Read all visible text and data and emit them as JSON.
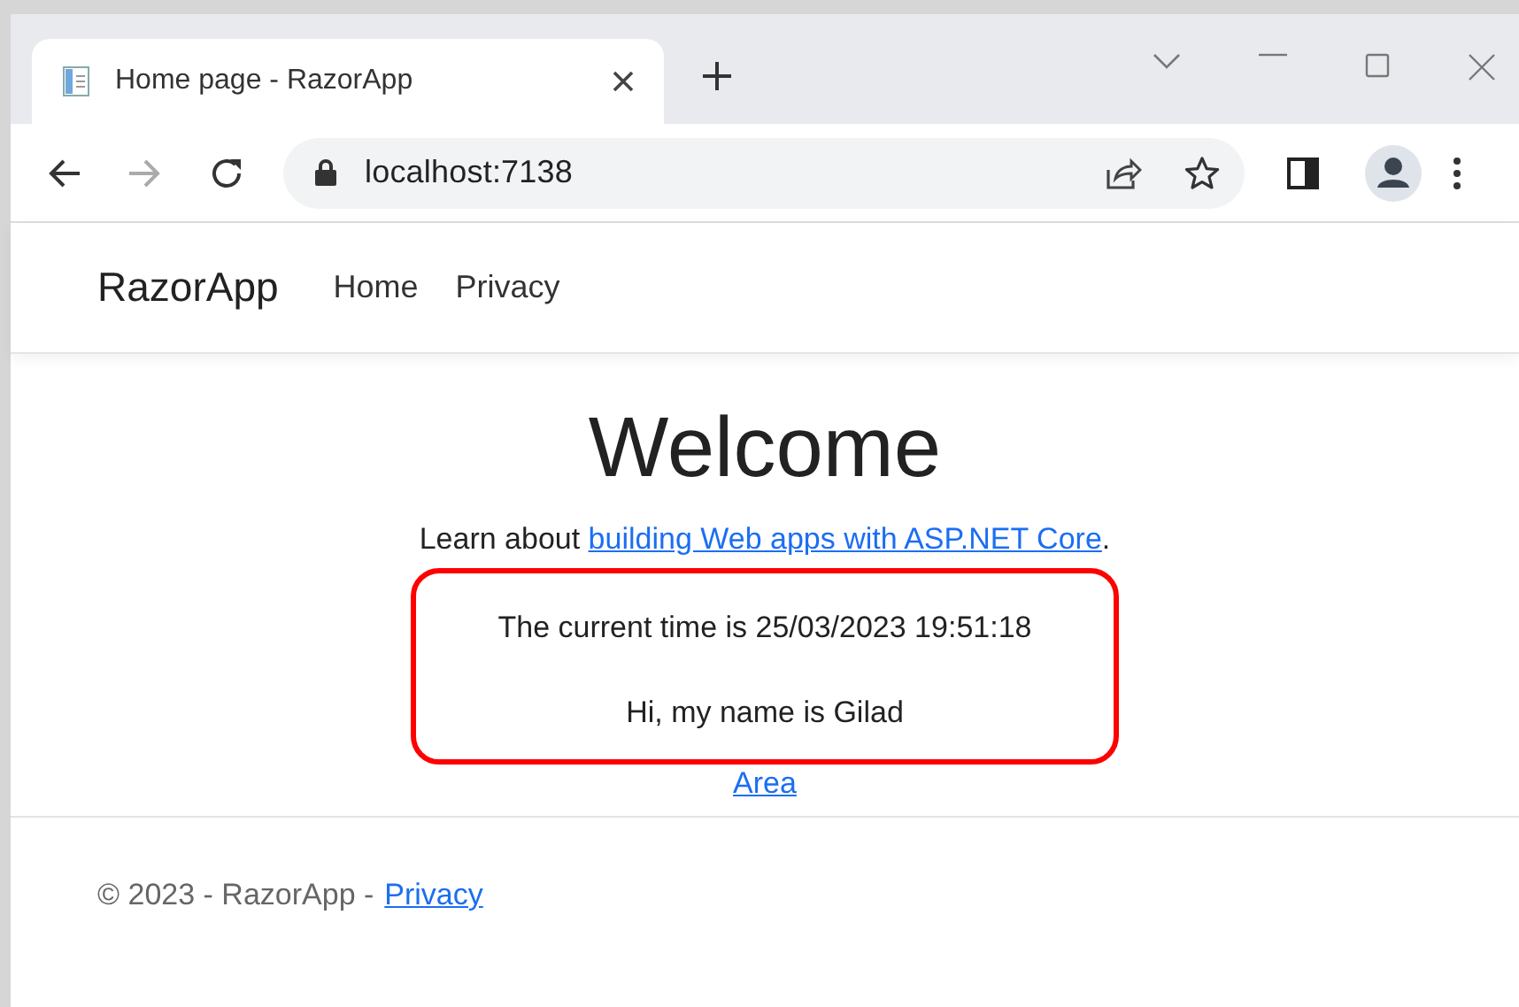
{
  "browser": {
    "tabs": [
      {
        "title": "Home page - RazorApp",
        "selected": true
      }
    ],
    "nav_buttons": [
      {
        "kind": "back",
        "disabled": false
      },
      {
        "kind": "forward",
        "disabled": true
      },
      {
        "kind": "reload",
        "disabled": false
      }
    ],
    "address": "localhost:7138"
  },
  "navbar": {
    "brand": "RazorApp",
    "links": [
      "Home",
      "Privacy"
    ]
  },
  "main": {
    "heading": "Welcome",
    "intro_before": "Learn about",
    "intro_link": "building Web apps with ASP.NET Core",
    "intro_after": ".",
    "highlighted_lines": [
      "The current time is 25/03/2023 19:51:18",
      "Hi, my name is Gilad"
    ],
    "area_link": "Area"
  },
  "footer": {
    "text": "© 2023 - RazorApp -",
    "link": "Privacy"
  }
}
